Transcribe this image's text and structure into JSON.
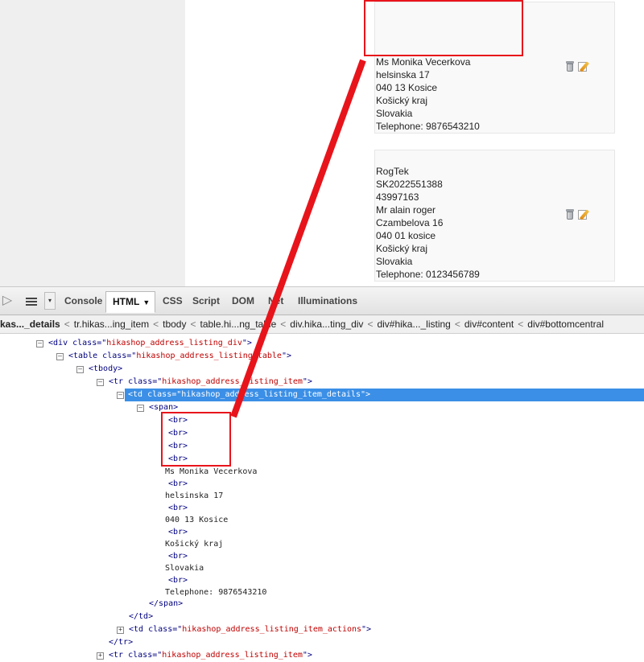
{
  "addresses": [
    {
      "lines": [
        "Ms Monika Vecerkova",
        "helsinska 17",
        "040 13 Kosice",
        "Košický kraj",
        "Slovakia",
        "Telephone: 9876543210"
      ]
    },
    {
      "lines": [
        "RogTek",
        "SK2022551388",
        "43997163",
        "Mr alain roger",
        "Czambelova 16",
        "040 01 kosice",
        "Košický kraj",
        "Slovakia",
        "Telephone: 0123456789"
      ]
    }
  ],
  "icons": {
    "delete": "trash-icon",
    "edit": "edit-icon",
    "inspect": "inspect-arrow-icon",
    "menu": "menu-icon"
  },
  "devtools": {
    "tabs": [
      "Console",
      "HTML",
      "CSS",
      "Script",
      "DOM",
      "Net",
      "Illuminations"
    ],
    "active_tab": "HTML",
    "breadcrumb": [
      "kas..._details",
      "tr.hikas...ing_item",
      "tbody",
      "table.hi...ng_table",
      "div.hika...ting_div",
      "div#hika..._listing",
      "div#content",
      "div#bottomcentral"
    ]
  },
  "tree": {
    "n1": {
      "tag": "div",
      "attr": "class",
      "val": "hikashop_address_listing_div"
    },
    "n2": {
      "tag": "table",
      "attr": "class",
      "val": "hikashop_address_listing_table"
    },
    "n3": "<tbody>",
    "n4": {
      "tag": "tr",
      "attr": "class",
      "val": "hikashop_address_listing_item"
    },
    "n5": {
      "tag": "td",
      "attr": "class",
      "val": "hikashop_address_listing_item_details"
    },
    "n6": "<span>",
    "br": "<br>",
    "t1": "Ms Monika Vecerkova",
    "t2": "helsinska 17",
    "t3": "040 13 Kosice",
    "t4": "Košický kraj",
    "t5": "Slovakia",
    "t6": "Telephone: 9876543210",
    "close_span": "</span>",
    "close_td": "</td>",
    "n7": {
      "tag": "td",
      "attr": "class",
      "val": "hikashop_address_listing_item_actions"
    },
    "close_tr": "</tr>",
    "n8": {
      "tag": "tr",
      "attr": "class",
      "val": "hikashop_address_listing_item"
    }
  },
  "colors": {
    "annotation": "#e8141b",
    "selection": "#3b8fe6",
    "attr_value": "#c00000",
    "tag": "#000080"
  }
}
